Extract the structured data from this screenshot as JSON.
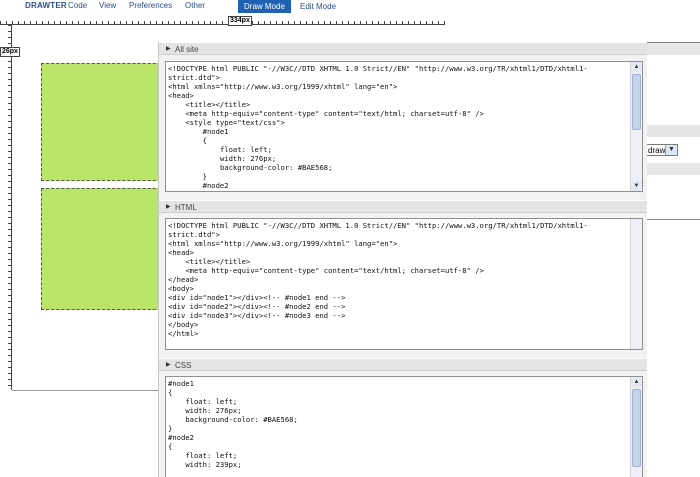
{
  "menu": {
    "brand": "DRAWTER",
    "items": [
      "Code",
      "View",
      "Preferences",
      "Other"
    ],
    "draw_mode": "Draw Mode",
    "edit_mode": "Edit Mode"
  },
  "rulers": {
    "width_label": "334px",
    "height_label": "26px"
  },
  "right_panel": {
    "select_value": "draw",
    "select_arrow": "▼"
  },
  "panels": {
    "all_site": {
      "title": "All site",
      "code": "<!DOCTYPE html PUBLIC \"-//W3C//DTD XHTML 1.0 Strict//EN\" \"http://www.w3.org/TR/xhtml1/DTD/xhtml1-\nstrict.dtd\">\n<html xmlns=\"http://www.w3.org/1999/xhtml\" lang=\"en\">\n<head>\n\t<title></title>\n\t<meta http-equiv=\"content-type\" content=\"text/html; charset=utf-8\" />\n\t<style type=\"text/css\">\n\t\t#node1\n\t\t{\n\t\t\tfloat: left;\n\t\t\twidth: 276px;\n\t\t\tbackground-color: #BAE568;\n\t\t}\n\t\t#node2"
    },
    "html": {
      "title": "HTML",
      "code": "<!DOCTYPE html PUBLIC \"-//W3C//DTD XHTML 1.0 Strict//EN\" \"http://www.w3.org/TR/xhtml1/DTD/xhtml1-\nstrict.dtd\">\n<html xmlns=\"http://www.w3.org/1999/xhtml\" lang=\"en\">\n<head>\n\t<title></title>\n\t<meta http-equiv=\"content-type\" content=\"text/html; charset=utf-8\" />\n</head>\n<body>\n<div id=\"node1\"></div><!-- #node1 end -->\n<div id=\"node2\"></div><!-- #node2 end -->\n<div id=\"node3\"></div><!-- #node3 end -->\n</body>\n</html>"
    },
    "css": {
      "title": "CSS",
      "code": "#node1\n{\n\tfloat: left;\n\twidth: 276px;\n\tbackground-color: #BAE568;\n}\n#node2\n{\n\tfloat: left;\n\twidth: 239px;"
    }
  },
  "colors": {
    "node_fill": "#bae568",
    "accent": "#1f62b4"
  },
  "icons": {
    "collapse": "triangle-right-icon",
    "scroll_up": "arrow-up-icon",
    "scroll_down": "arrow-down-icon"
  }
}
